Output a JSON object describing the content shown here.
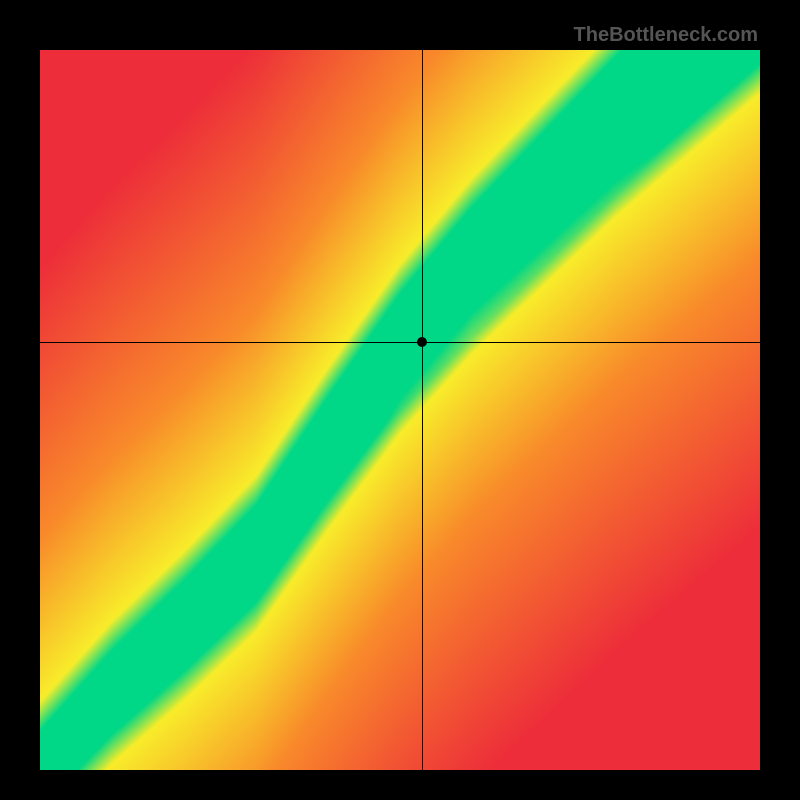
{
  "watermark": "TheBottleneck.com",
  "chart_data": {
    "type": "heatmap",
    "title": "",
    "xlabel": "",
    "ylabel": "",
    "xlim": [
      0,
      1
    ],
    "ylim": [
      0,
      1
    ],
    "crosshair": {
      "x": 0.53,
      "y": 0.595
    },
    "marker_point": {
      "x": 0.53,
      "y": 0.595
    },
    "green_ridge_points": [
      {
        "x": 0.0,
        "y": 0.0
      },
      {
        "x": 0.1,
        "y": 0.11
      },
      {
        "x": 0.2,
        "y": 0.2
      },
      {
        "x": 0.3,
        "y": 0.3
      },
      {
        "x": 0.4,
        "y": 0.46
      },
      {
        "x": 0.5,
        "y": 0.61
      },
      {
        "x": 0.6,
        "y": 0.73
      },
      {
        "x": 0.7,
        "y": 0.83
      },
      {
        "x": 0.8,
        "y": 0.93
      },
      {
        "x": 0.88,
        "y": 1.0
      }
    ],
    "color_stops": {
      "red": "#ed2d3a",
      "orange": "#f98a2b",
      "yellow": "#f8ed2a",
      "green": "#00d888"
    },
    "description": "2D gradient field: green along diagonal ridge, transitioning through yellow and orange to red at off-diagonal corners. Crosshair and black dot mark a point just above the ridge at approx (0.53, 0.595)."
  }
}
